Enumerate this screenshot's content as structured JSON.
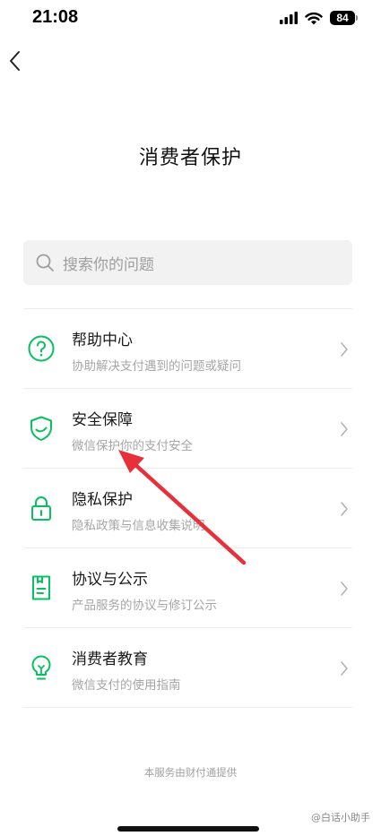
{
  "status_bar": {
    "time": "21:08",
    "battery": "84"
  },
  "header": {
    "title": "消费者保护"
  },
  "search": {
    "placeholder": "搜索你的问题"
  },
  "menu": {
    "items": [
      {
        "title": "帮助中心",
        "subtitle": "协助解决支付遇到的问题或疑问",
        "icon": "help-circle-icon"
      },
      {
        "title": "安全保障",
        "subtitle": "微信保护你的支付安全",
        "icon": "shield-check-icon"
      },
      {
        "title": "隐私保护",
        "subtitle": "隐私政策与信息收集说明",
        "icon": "lock-icon"
      },
      {
        "title": "协议与公示",
        "subtitle": "产品服务的协议与修订公示",
        "icon": "document-icon"
      },
      {
        "title": "消费者教育",
        "subtitle": "微信支付的使用指南",
        "icon": "lightbulb-icon"
      }
    ]
  },
  "footer": {
    "note": "本服务由财付通提供"
  },
  "watermark": {
    "text": "@白话小助手"
  },
  "colors": {
    "accent": "#07c160",
    "annotation_arrow": "#e8303a"
  }
}
